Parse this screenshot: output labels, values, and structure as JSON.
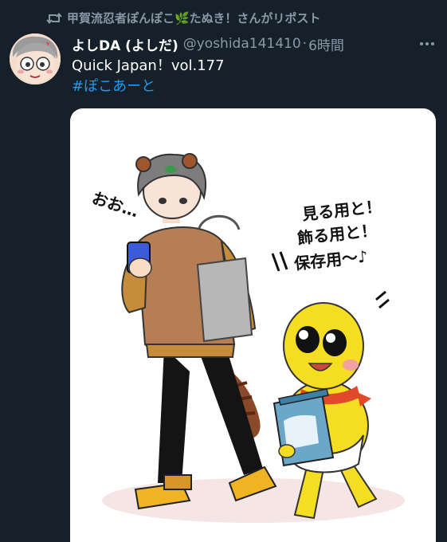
{
  "retweet": {
    "icon": "retweet-icon",
    "text": "甲賀流忍者ぽんぽこ🌿たぬき！さんがリポスト"
  },
  "author": {
    "display_name": "よしDA (よしだ)",
    "handle": "@yoshida141410",
    "separator": "·",
    "time": "6時間"
  },
  "tweet": {
    "text": "Quick Japan！vol.177",
    "hashtag": "#ぽこあーと"
  },
  "image": {
    "speech_left": "おお…",
    "speech_right_1": "見る用と！",
    "speech_right_2": "飾る用と！",
    "speech_right_3": "保存用〜♪"
  },
  "colors": {
    "background": "#15202b",
    "secondary_text": "#8b98a5",
    "link": "#1d9bf0"
  }
}
